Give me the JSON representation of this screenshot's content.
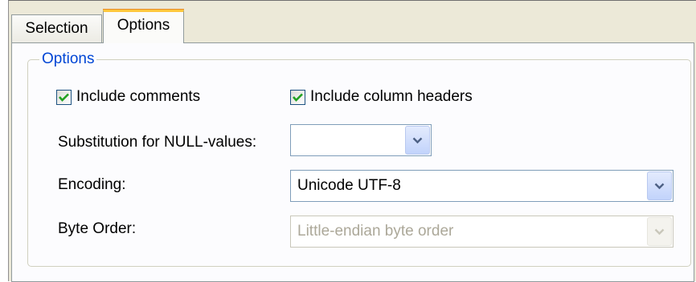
{
  "tabs": {
    "selection": "Selection",
    "options": "Options"
  },
  "group": {
    "title": "Options"
  },
  "checkboxes": {
    "include_comments": {
      "label": "Include comments",
      "checked": true
    },
    "include_column_headers": {
      "label": "Include column headers",
      "checked": true
    }
  },
  "fields": {
    "null_substitution": {
      "label": "Substitution for NULL-values:",
      "value": ""
    },
    "encoding": {
      "label": "Encoding:",
      "value": "Unicode UTF-8"
    },
    "byte_order": {
      "label": "Byte Order:",
      "value": "Little-endian byte order",
      "disabled": true
    }
  },
  "icons": {
    "check": "checkmark-icon",
    "dropdown": "chevron-down-icon"
  },
  "colors": {
    "accent_tab": "#ffc73c",
    "group_title": "#0046d5",
    "check_green": "#21a121",
    "dropdown_arrow": "#4d6185"
  }
}
